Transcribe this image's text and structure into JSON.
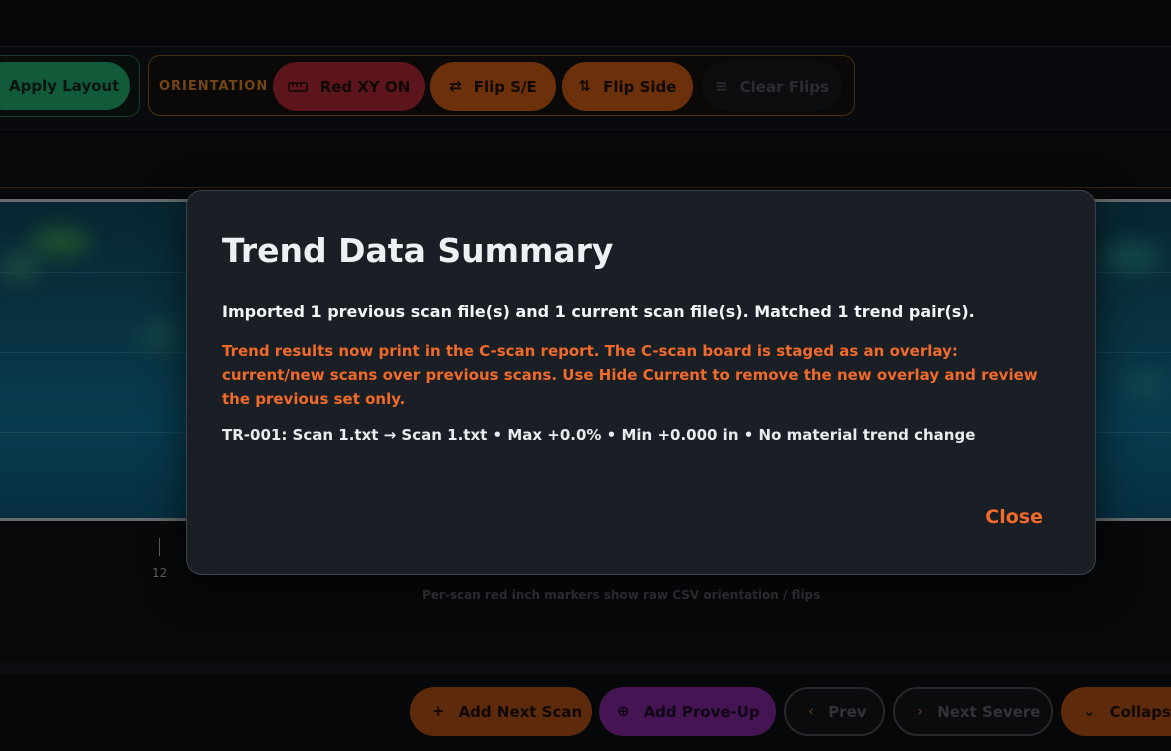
{
  "toolbar": {
    "apply_layout_label": "Apply Layout",
    "orientation_label": "ORIENTATION",
    "red_xy_label": "Red XY ON",
    "flip_se_label": "Flip S/E",
    "flip_side_label": "Flip Side",
    "clear_flips_label": "Clear Flips"
  },
  "board": {
    "tick_label": "12",
    "note": "Per-scan red inch markers show raw CSV orientation / flips"
  },
  "bottom_bar": {
    "add_next_scan_label": "Add Next Scan",
    "add_prove_up_label": "Add Prove-Up",
    "prev_label": "Prev",
    "next_severe_label": "Next Severe",
    "collapse_label": "Collapse"
  },
  "modal": {
    "title": "Trend Data Summary",
    "import_summary": "Imported 1 previous scan file(s) and 1 current scan file(s). Matched 1 trend pair(s).",
    "overlay_notice": "Trend results now print in the C-scan report. The C-scan board is staged as an overlay: current/new scans over previous scans. Use Hide Current to remove the new overlay and review the previous set only.",
    "trend_line": "TR-001: Scan 1.txt → Scan 1.txt • Max +0.0% • Min +0.000 in • No material trend change",
    "close_label": "Close"
  },
  "icons": {
    "red_xy": "ruler-icon",
    "flip_se": "arrows-left-right-icon",
    "flip_side": "arrows-up-down-icon",
    "clear_flips": "list-lines-icon",
    "add_next_scan": "plus-icon",
    "add_prove_up": "plus-circle-icon",
    "prev": "chevron-left-icon",
    "next_severe": "chevron-right-icon",
    "collapse": "chevron-down-icon"
  },
  "colors": {
    "accent_orange": "#f06a2a",
    "apply_green": "#1b8a5a",
    "red_pill": "#8e2129",
    "prove_purple": "#6a1f80",
    "modal_bg": "#1a1f25"
  }
}
